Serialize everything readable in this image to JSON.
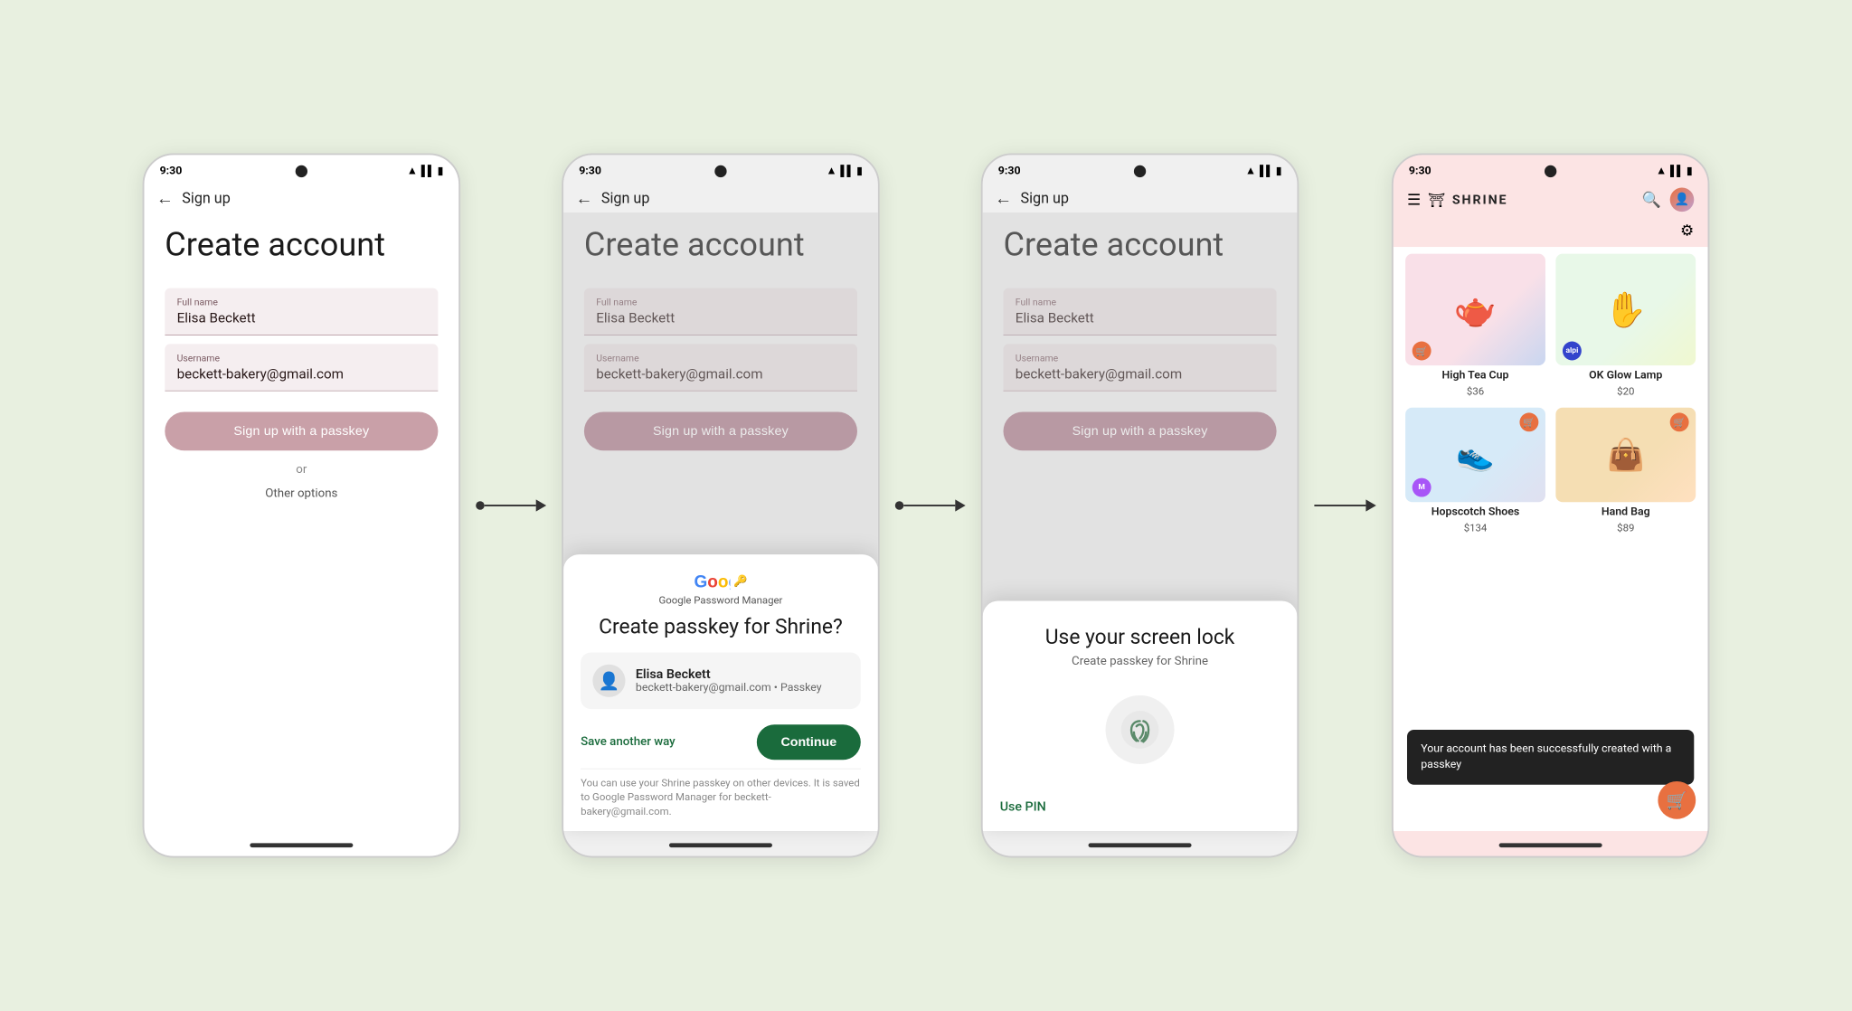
{
  "screen1": {
    "time": "9:30",
    "nav_title": "Sign up",
    "create_title": "Create account",
    "full_name_label": "Full name",
    "full_name_value": "Elisa Beckett",
    "username_label": "Username",
    "username_value": "beckett-bakery@gmail.com",
    "passkey_btn": "Sign up with a passkey",
    "or_text": "or",
    "other_options": "Other options"
  },
  "screen2": {
    "time": "9:30",
    "nav_title": "Sign up",
    "create_title": "Create account",
    "full_name_label": "Full name",
    "full_name_value": "Elisa Beckett",
    "username_label": "Username",
    "username_value": "beckett-bakery@gmail.com",
    "passkey_btn": "Sign up with a passkey",
    "modal": {
      "gpm_title": "Google Password Manager",
      "modal_title": "Create passkey for Shrine?",
      "user_name": "Elisa Beckett",
      "user_email": "beckett-bakery@gmail.com • Passkey",
      "save_another_way": "Save another way",
      "continue_btn": "Continue",
      "note": "You can use your Shrine passkey on other devices. It is saved to Google Password Manager for beckett-bakery@gmail.com."
    }
  },
  "screen3": {
    "time": "9:30",
    "nav_title": "Sign up",
    "create_title": "Create account",
    "full_name_label": "Full name",
    "full_name_value": "Elisa Beckett",
    "username_label": "Username",
    "username_value": "beckett-bakery@gmail.com",
    "passkey_btn": "Sign up with a passkey",
    "lock_modal": {
      "title": "Use your screen lock",
      "subtitle": "Create passkey for Shrine",
      "use_pin": "Use PIN"
    }
  },
  "screen4": {
    "time": "9:30",
    "shrine_title": "SHRINE",
    "products": [
      {
        "name": "High Tea Cup",
        "price": "$36",
        "color": "img-tea",
        "icon": "🫖"
      },
      {
        "name": "OK Glow Lamp",
        "price": "$20",
        "color": "img-lamp",
        "icon": "✋"
      },
      {
        "name": "Hopscotch Shoes",
        "price": "$134",
        "color": "img-shoes",
        "icon": "👟",
        "badge": "M",
        "badge_color": "#a855f7"
      },
      {
        "name": "Hand Bag",
        "price": "$89",
        "color": "img-bag",
        "icon": "👜"
      }
    ],
    "toast": "Your account has been successfully created with a passkey"
  },
  "arrows": {
    "arrow1": "→",
    "arrow2": "→"
  }
}
